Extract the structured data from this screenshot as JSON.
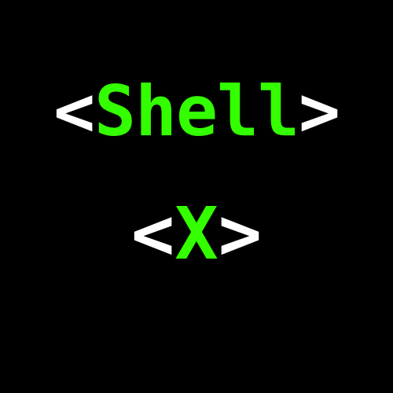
{
  "logo": {
    "line1": {
      "open_bracket": "<",
      "word": "Shell",
      "close_bracket": ">"
    },
    "line2": {
      "open_bracket": "<",
      "word": "X",
      "close_bracket": ">"
    }
  },
  "colors": {
    "background": "#000000",
    "bracket": "#ffffff",
    "accent_green": "#33ff00"
  }
}
